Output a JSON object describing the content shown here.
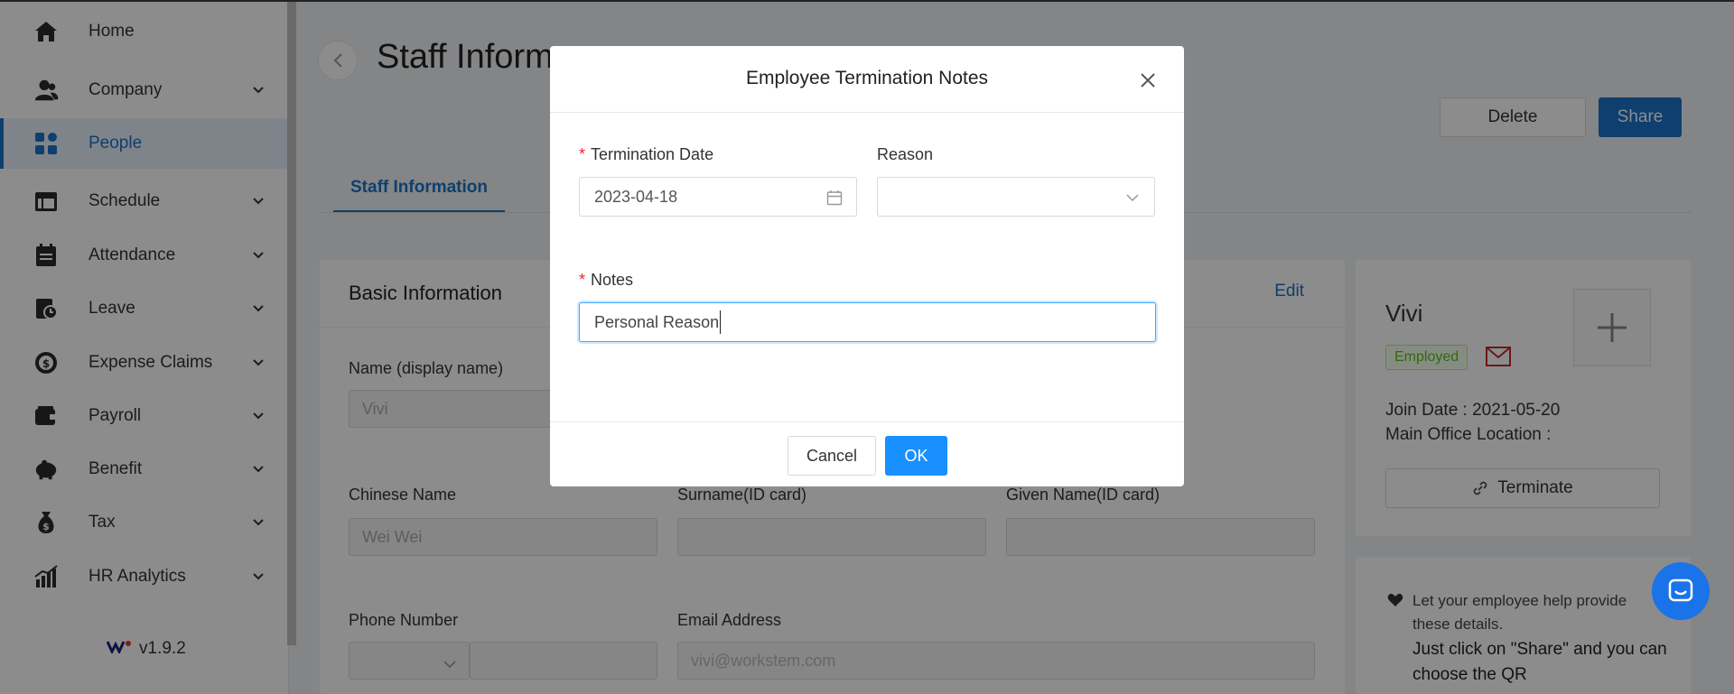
{
  "sidebar": {
    "items": [
      {
        "label": "Home",
        "icon": "home-icon"
      },
      {
        "label": "Company",
        "icon": "company-icon"
      },
      {
        "label": "People",
        "icon": "people-icon"
      },
      {
        "label": "Schedule",
        "icon": "schedule-icon"
      },
      {
        "label": "Attendance",
        "icon": "attendance-icon"
      },
      {
        "label": "Leave",
        "icon": "leave-icon"
      },
      {
        "label": "Expense Claims",
        "icon": "expense-icon"
      },
      {
        "label": "Payroll",
        "icon": "payroll-icon"
      },
      {
        "label": "Benefit",
        "icon": "benefit-icon"
      },
      {
        "label": "Tax",
        "icon": "tax-icon"
      },
      {
        "label": "HR Analytics",
        "icon": "analytics-icon"
      }
    ],
    "active_item": "People",
    "version": "v1.9.2"
  },
  "header": {
    "title": "Staff Inform",
    "delete_label": "Delete",
    "share_label": "Share"
  },
  "tabs": {
    "active": "Staff Information"
  },
  "basic_info": {
    "title": "Basic Information",
    "edit_label": "Edit",
    "name_label": "Name (display name)",
    "name_value": "Vivi",
    "chinese_name_label": "Chinese Name",
    "chinese_name_value": "Wei Wei",
    "surname_label": "Surname(ID card)",
    "given_name_label": "Given Name(ID card)",
    "phone_label": "Phone Number",
    "email_label": "Email Address",
    "email_placeholder": "vivi@workstem.com"
  },
  "profile": {
    "name": "Vivi",
    "status": "Employed",
    "join_date": "Join Date : 2021-05-20",
    "main_office": "Main Office Location :",
    "terminate_label": "Terminate"
  },
  "help": {
    "line1": "Let your employee help provide these details.",
    "line2": "Just click on \"Share\" and you can choose the QR"
  },
  "modal": {
    "title": "Employee Termination Notes",
    "termination_date_label": "Termination Date",
    "termination_date_value": "2023-04-18",
    "reason_label": "Reason",
    "reason_value": "",
    "notes_label": "Notes",
    "notes_value": "Personal Reason",
    "cancel_label": "Cancel",
    "ok_label": "OK"
  },
  "colors": {
    "accent": "#1a73c8",
    "ok_button": "#1890ff",
    "required": "#f5222d",
    "employed_badge": "#52c41a",
    "chat": "#1a73e8"
  }
}
